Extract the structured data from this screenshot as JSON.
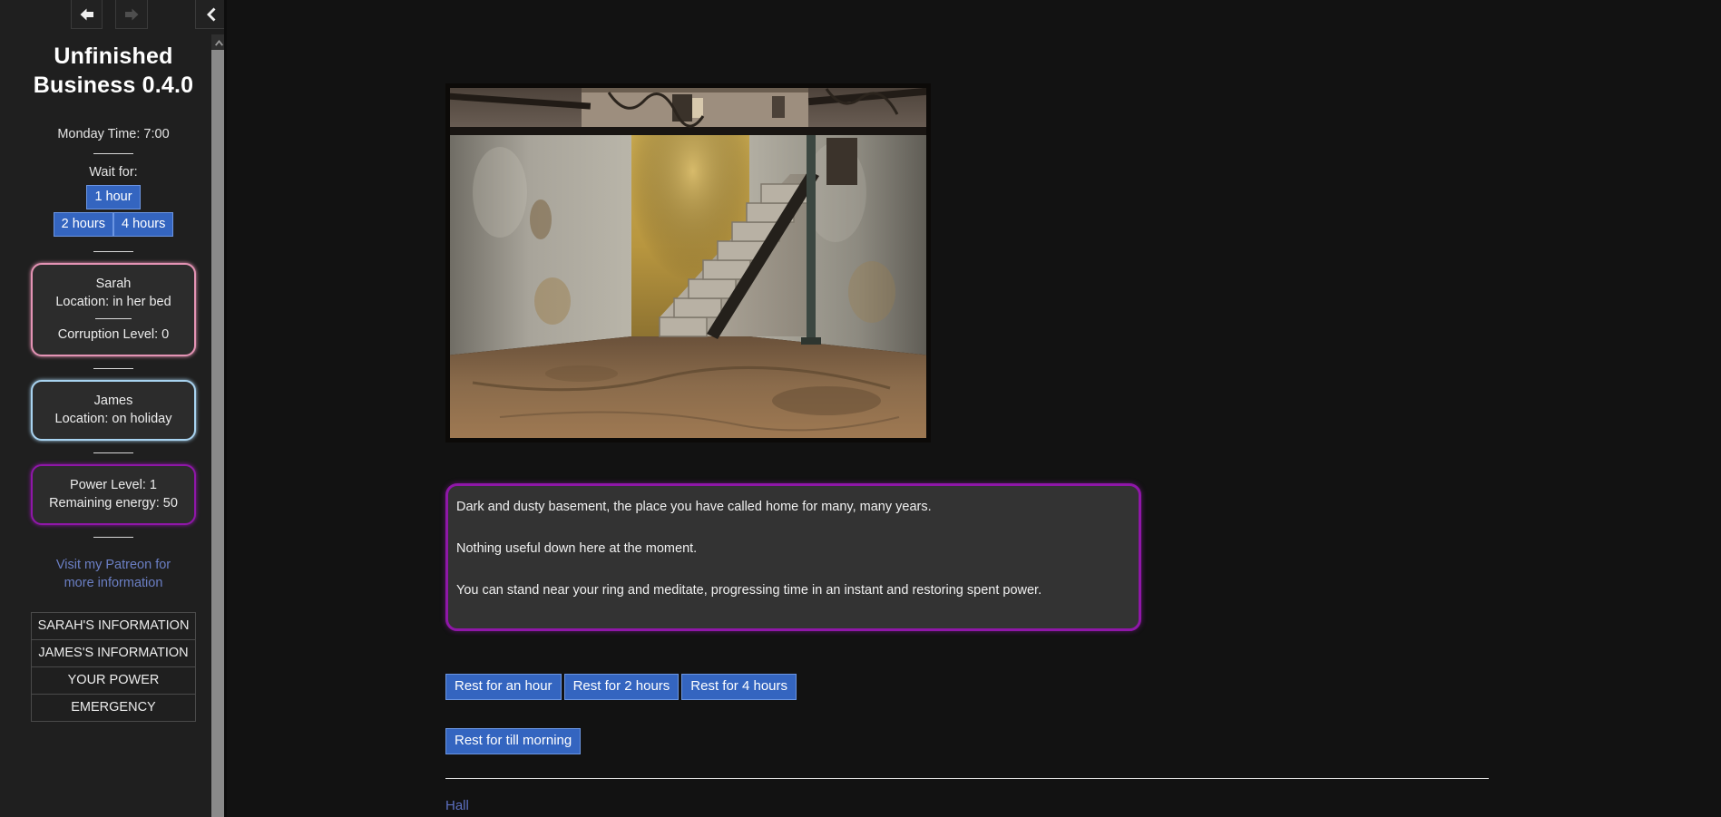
{
  "sidebar": {
    "nav": {
      "back_icon": "arrow-left-icon",
      "forward_icon": "arrow-right-icon",
      "collapse_icon": "chevron-left-icon",
      "back_enabled": true,
      "forward_enabled": false
    },
    "app_title": "Unfinished Business 0.4.0",
    "clock": "Monday Time: 7:00",
    "wait_label": "Wait for:",
    "wait_buttons": [
      "1 hour",
      "2 hours",
      "4 hours"
    ],
    "sarah": {
      "name": "Sarah",
      "location": "Location: in her bed",
      "corruption": "Corruption Level: 0",
      "border_color": "#e493b4"
    },
    "james": {
      "name": "James",
      "location": "Location: on holiday",
      "border_color": "#a8d3f0"
    },
    "power": {
      "level": "Power Level: 1",
      "energy": "Remaining energy: 50",
      "border_color": "#8f17a8"
    },
    "patreon_link": "Visit my Patreon for more information",
    "menu": [
      "SARAH'S INFORMATION",
      "JAMES'S INFORMATION",
      "YOUR POWER",
      "EMERGENCY"
    ],
    "scrollbar": {
      "up_icon": "chevron-up-icon"
    }
  },
  "main": {
    "scene_image_alt": "basement-photo",
    "story": [
      "Dark and dusty basement, the place you have called home for many, many years.",
      "Nothing useful down here at the moment.",
      "You can stand near your ring and meditate, progressing time in an instant and restoring spent power."
    ],
    "actions_row1": [
      "Rest for an hour",
      "Rest for 2 hours",
      "Rest for 4 hours"
    ],
    "actions_row2": [
      "Rest for till morning"
    ],
    "exit_link": "Hall",
    "accent_button_color": "#3465c0",
    "link_color": "#5c6fc0"
  }
}
